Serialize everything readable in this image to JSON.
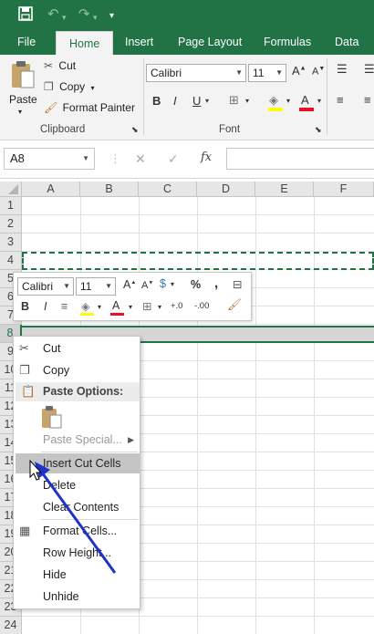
{
  "quick_access": {
    "save_icon": "save-icon",
    "undo_icon": "undo-icon",
    "redo_icon": "redo-icon",
    "customize_icon": "customize-qat-icon"
  },
  "tabs": [
    {
      "label": "File",
      "active": false
    },
    {
      "label": "Home",
      "active": true
    },
    {
      "label": "Insert",
      "active": false
    },
    {
      "label": "Page Layout",
      "active": false
    },
    {
      "label": "Formulas",
      "active": false
    },
    {
      "label": "Data",
      "active": false
    }
  ],
  "ribbon": {
    "clipboard": {
      "label": "Clipboard",
      "paste": "Paste",
      "cut": "Cut",
      "copy": "Copy",
      "format_painter": "Format Painter"
    },
    "font": {
      "label": "Font",
      "name": "Calibri",
      "size": "11",
      "bold": "B",
      "italic": "I",
      "underline": "U",
      "grow": "A",
      "shrink": "A",
      "font_color": "A"
    }
  },
  "formula_bar": {
    "name_box": "A8",
    "cancel": "✕",
    "enter": "✓",
    "fx": "fx",
    "value": ""
  },
  "grid": {
    "columns": [
      "A",
      "B",
      "C",
      "D",
      "E",
      "F"
    ],
    "rows": [
      "1",
      "2",
      "3",
      "4",
      "5",
      "6",
      "7",
      "8",
      "9",
      "10",
      "11",
      "12",
      "13",
      "14",
      "15",
      "16",
      "17",
      "18",
      "19",
      "20",
      "21",
      "22",
      "23",
      "24"
    ]
  },
  "mini_toolbar": {
    "font_name": "Calibri",
    "font_size": "11",
    "grow": "A",
    "shrink": "A",
    "percent": "%",
    "comma": ",",
    "bold": "B",
    "italic": "I",
    "font_color": "A",
    "inc_decimal": "+.0",
    "dec_decimal": "-.00"
  },
  "context_menu": {
    "cut": "Cut",
    "copy": "Copy",
    "paste_options": "Paste Options:",
    "paste_special": "Paste Special...",
    "insert_cut_cells": "Insert Cut Cells",
    "delete": "Delete",
    "clear_contents": "Clear Contents",
    "format_cells": "Format Cells...",
    "row_height": "Row Height...",
    "hide": "Hide",
    "unhide": "Unhide"
  },
  "colors": {
    "accent": "#217346",
    "annotation_arrow": "#1f33c8",
    "menu_highlight": "#c5c5c5"
  }
}
